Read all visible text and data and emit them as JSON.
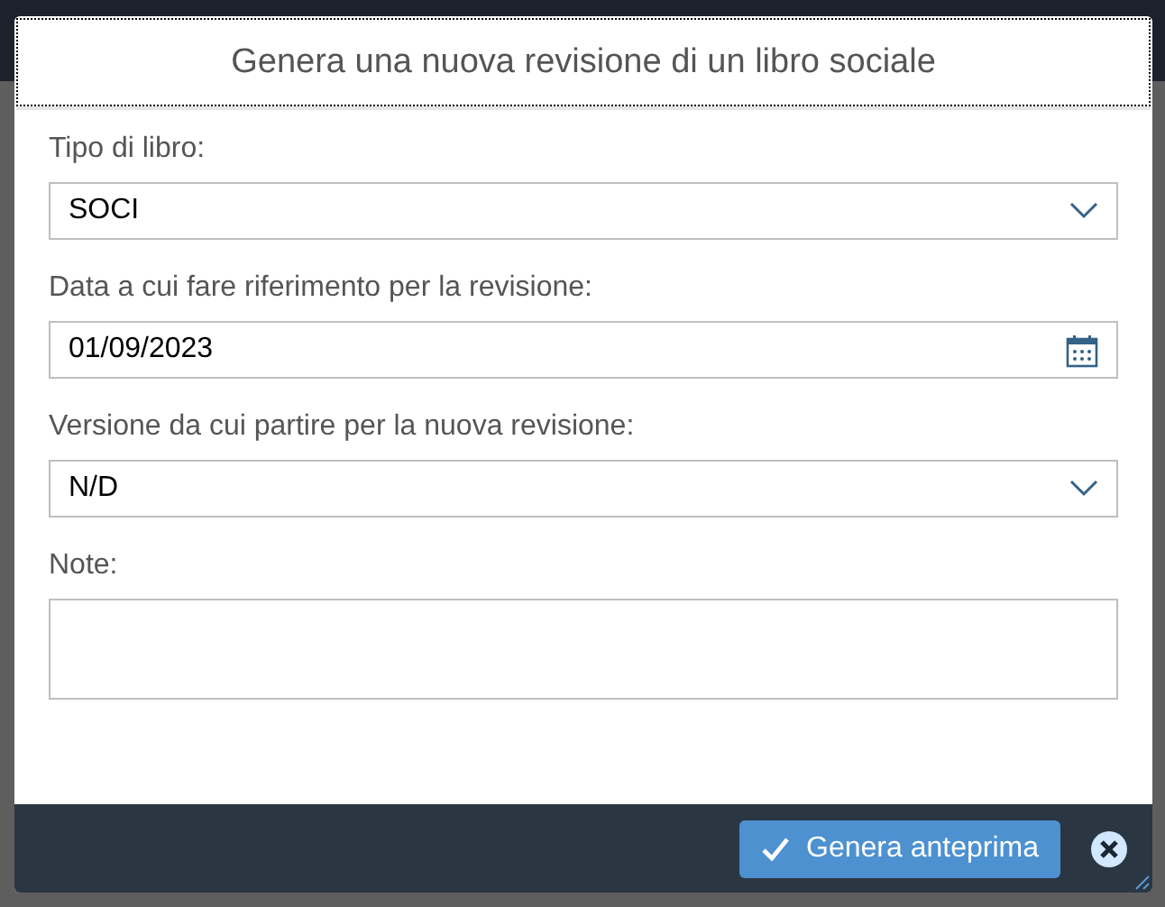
{
  "dialog": {
    "title": "Genera una nuova revisione di un libro sociale"
  },
  "fields": [
    {
      "label": "Tipo di libro:",
      "kind": "select",
      "value": "SOCI"
    },
    {
      "label": "Data a cui fare riferimento per la revisione:",
      "kind": "date",
      "value": "01/09/2023"
    },
    {
      "label": "Versione da cui partire per la nuova revisione:",
      "kind": "select",
      "value": "N/D"
    },
    {
      "label": "Note:",
      "kind": "textarea"
    }
  ],
  "buttons": [
    {
      "label": "Genera anteprima",
      "kind": "primary"
    },
    {
      "kind": "close"
    }
  ]
}
